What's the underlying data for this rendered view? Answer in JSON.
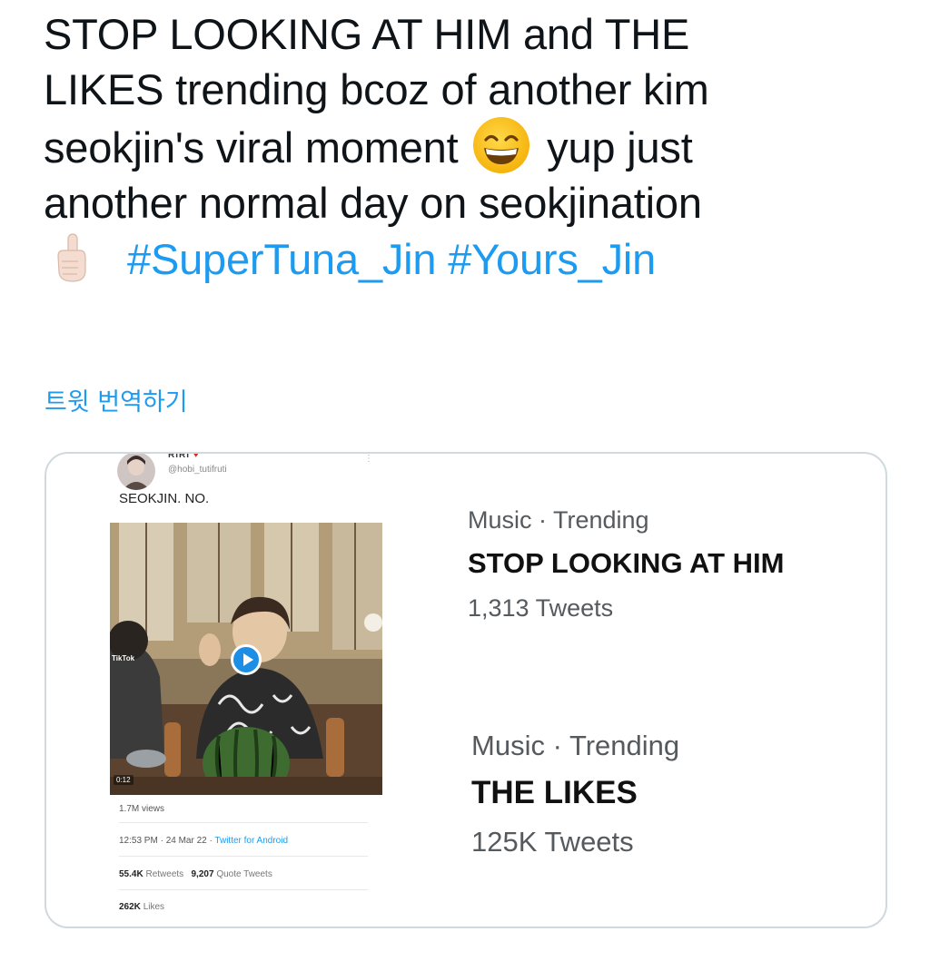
{
  "tweet": {
    "lines": [
      "STOP LOOKING AT HIM and THE",
      "LIKES trending bcoz of another kim",
      "seokjin's viral moment",
      "yup just",
      "another normal day on seokjination"
    ],
    "hashtags": [
      "#SuperTuna_Jin",
      "#Yours_Jin"
    ],
    "emoji": [
      "grinning-face-with-smiling-eyes-icon",
      "backhand-index-pointing-up-icon"
    ],
    "translate_label": "트윗 번역하기",
    "link_color": "#1d9bf0"
  },
  "embedded_tweet": {
    "name": "RIRI",
    "handle": "@hobi_tutifruti",
    "caption": "SEOKJIN. NO.",
    "tiktok_label": "TikTok",
    "duration": "0:12",
    "views": "1.7M views",
    "time": "12:53 PM · 24 Mar 22 · ",
    "app": "Twitter for Android",
    "retweets_count": "55.4K",
    "retweets_label": "Retweets",
    "quotes_count": "9,207",
    "quotes_label": "Quote Tweets",
    "likes_count": "262K",
    "likes_label": "Likes"
  },
  "trends": [
    {
      "category": "Music · Trending",
      "title": "STOP LOOKING AT HIM",
      "count": "1,313 Tweets"
    },
    {
      "category": "Music · Trending",
      "title": "THE LIKES",
      "count": "125K Tweets"
    }
  ]
}
